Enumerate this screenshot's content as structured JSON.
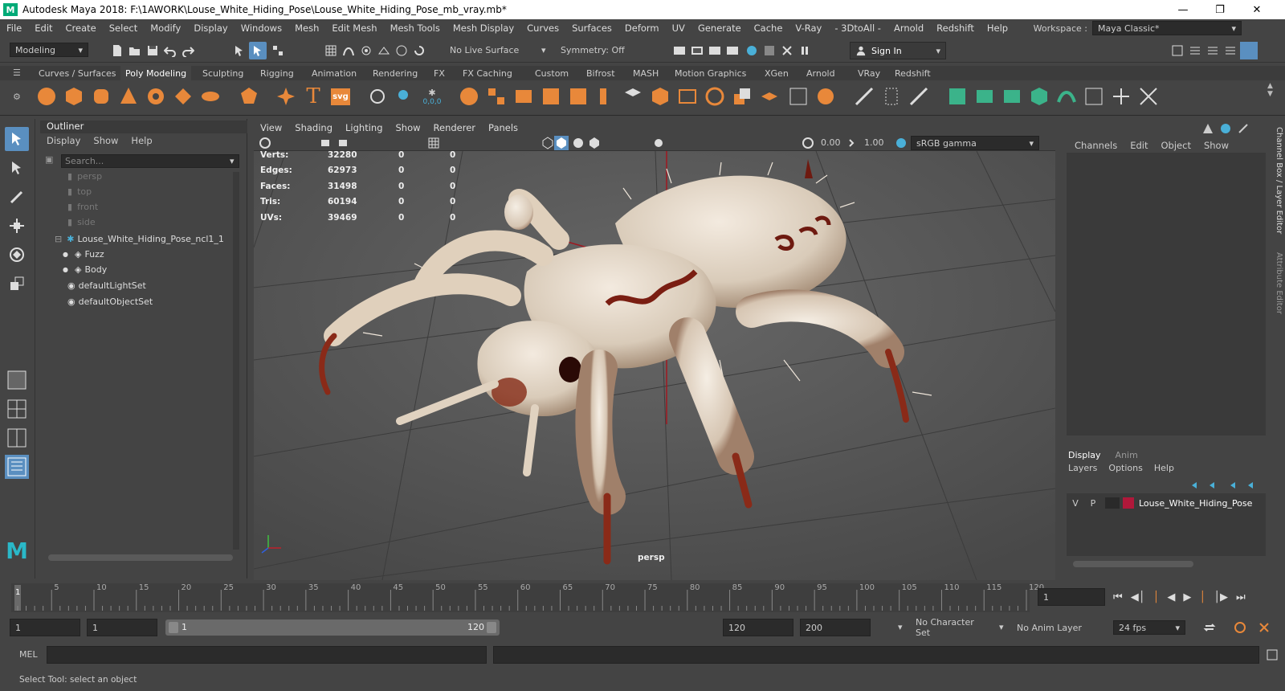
{
  "window": {
    "title": "Autodesk Maya 2018: F:\\1AWORK\\Louse_White_Hiding_Pose\\Louse_White_Hiding_Pose_mb_vray.mb*",
    "logo": "M",
    "controls": [
      "minimize-icon",
      "restore-icon",
      "close-icon"
    ]
  },
  "menubar": {
    "items": [
      "File",
      "Edit",
      "Create",
      "Select",
      "Modify",
      "Display",
      "Windows",
      "Mesh",
      "Edit Mesh",
      "Mesh Tools",
      "Mesh Display",
      "Curves",
      "Surfaces",
      "Deform",
      "UV",
      "Generate",
      "Cache",
      "V-Ray",
      "- 3DtoAll -",
      "Arnold",
      "Redshift",
      "Help"
    ],
    "workspace_label": "Workspace :",
    "workspace_value": "Maya Classic*"
  },
  "statusline": {
    "mode": "Modeling",
    "live_surface": "No Live Surface",
    "symmetry": "Symmetry: Off",
    "sign_in": "Sign In"
  },
  "shelf": {
    "tabs": [
      "Curves / Surfaces",
      "Poly Modeling",
      "Sculpting",
      "Rigging",
      "Animation",
      "Rendering",
      "FX",
      "FX Caching",
      "Custom",
      "Bifrost",
      "MASH",
      "Motion Graphics",
      "XGen",
      "Arnold",
      "VRay",
      "Redshift"
    ],
    "active_tab": "Poly Modeling",
    "text_icon": "T",
    "svg_icon": "svg",
    "origin_icon": "0,0,0"
  },
  "outliner": {
    "title": "Outliner",
    "menu": [
      "Display",
      "Show",
      "Help"
    ],
    "search_placeholder": "Search...",
    "items": [
      {
        "label": "persp",
        "dim": true
      },
      {
        "label": "top",
        "dim": true
      },
      {
        "label": "front",
        "dim": true
      },
      {
        "label": "side",
        "dim": true
      },
      {
        "label": "Louse_White_Hiding_Pose_ncl1_1",
        "dim": false
      },
      {
        "label": "Fuzz",
        "dim": false
      },
      {
        "label": "Body",
        "dim": false
      },
      {
        "label": "defaultLightSet",
        "dim": false
      },
      {
        "label": "defaultObjectSet",
        "dim": false
      }
    ]
  },
  "viewport": {
    "menu": [
      "View",
      "Shading",
      "Lighting",
      "Show",
      "Renderer",
      "Panels"
    ],
    "exposure": "0.00",
    "gamma": "1.00",
    "colorspace": "sRGB gamma",
    "camera": "persp",
    "hud": [
      {
        "label": "Verts:",
        "v1": "32280",
        "v2": "0",
        "v3": "0"
      },
      {
        "label": "Edges:",
        "v1": "62973",
        "v2": "0",
        "v3": "0"
      },
      {
        "label": "Faces:",
        "v1": "31498",
        "v2": "0",
        "v3": "0"
      },
      {
        "label": "Tris:",
        "v1": "60194",
        "v2": "0",
        "v3": "0"
      },
      {
        "label": "UVs:",
        "v1": "39469",
        "v2": "0",
        "v3": "0"
      }
    ]
  },
  "channelbox": {
    "menu": [
      "Channels",
      "Edit",
      "Object",
      "Show"
    ],
    "side_tabs": [
      "Channel Box / Layer Editor",
      "Attribute Editor"
    ],
    "layer_tabs": [
      "Display",
      "Anim"
    ],
    "layer_menu": [
      "Layers",
      "Options",
      "Help"
    ],
    "layer": {
      "v": "V",
      "p": "P",
      "name": "Louse_White_Hiding_Pose",
      "color": "#b0183a"
    }
  },
  "timeline": {
    "ticks": [
      "5",
      "10",
      "15",
      "20",
      "25",
      "30",
      "35",
      "40",
      "45",
      "50",
      "55",
      "60",
      "65",
      "70",
      "75",
      "80",
      "85",
      "90",
      "95",
      "100",
      "105",
      "110",
      "115",
      "120"
    ],
    "current_frame_marker": "1",
    "current_frame": "1"
  },
  "range": {
    "start": "1",
    "playback_start": "1",
    "slider_start": "1",
    "slider_end": "120",
    "playback_end": "120",
    "end": "200",
    "character_set": "No Character Set",
    "anim_layer": "No Anim Layer",
    "fps": "24 fps"
  },
  "mel": {
    "label": "MEL"
  },
  "help": {
    "text": "Select Tool: select an object"
  },
  "colors": {
    "accent": "#4a90c8",
    "shelf_orange": "#e8883a",
    "shelf_green": "#3bb38a",
    "axis_red": "#c0202a",
    "axis_green": "#40c040",
    "axis_blue": "#3060e0"
  }
}
